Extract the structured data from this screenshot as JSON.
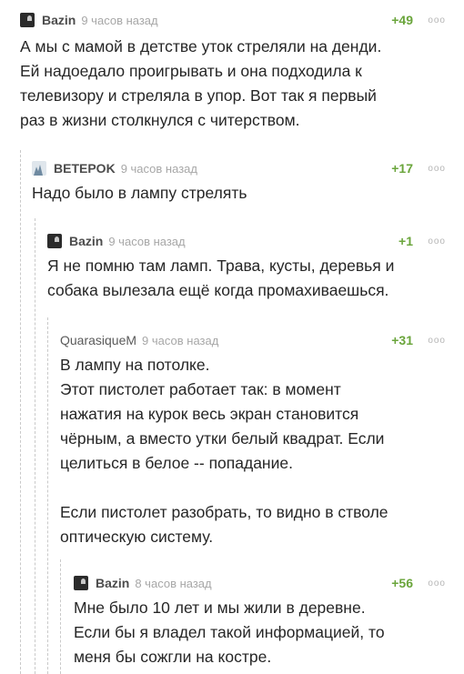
{
  "comments": [
    {
      "author": "Bazin",
      "time": "9 часов назад",
      "rating": "+49",
      "more": "ooo",
      "avatar": "dark-avatar",
      "text": "А мы с мамой в детстве уток стреляли на денди.\nЕй надоедало проигрывать и она подходила к\nтелевизору и стреляла в упор. Вот так я первый\nраз в жизни столкнулся с читерством."
    },
    {
      "author": "BETEPOK",
      "time": "9 часов назад",
      "rating": "+17",
      "more": "ooo",
      "avatar": "landscape-avatar",
      "text": "Надо было в лампу стрелять"
    },
    {
      "author": "Bazin",
      "time": "9 часов назад",
      "rating": "+1",
      "more": "ooo",
      "avatar": "dark-avatar",
      "text": "Я не помню там ламп. Трава, кусты, деревья и\nсобака вылезала ещё когда промахиваешься."
    },
    {
      "author": "QuarasiqueM",
      "time": "9 часов назад",
      "rating": "+31",
      "more": "ooo",
      "avatar": "",
      "text": "В лампу на потолке.\nЭтот пистолет работает так: в момент\nнажатия на курок весь экран становится\nчёрным, а вместо утки белый квадрат. Если\nцелиться в белое -- попадание.\n\nЕсли пистолет разобрать, то видно в стволе\nоптическую систему."
    },
    {
      "author": "Bazin",
      "time": "8 часов назад",
      "rating": "+56",
      "more": "ooo",
      "avatar": "dark-avatar",
      "text": "Мне было 10 лет и мы жили в деревне.\nЕсли бы я владел такой информацией, то\nменя бы сожгли на костре."
    }
  ]
}
